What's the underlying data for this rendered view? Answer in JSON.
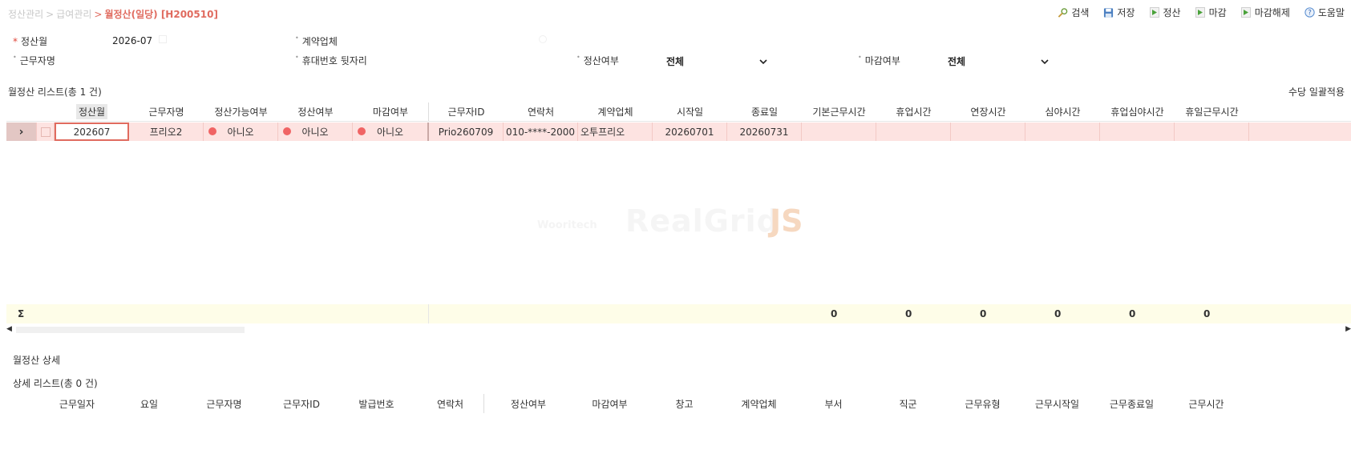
{
  "breadcrumb": {
    "crumb1": "정산관리",
    "crumb2": "급여관리",
    "current": "월정산(일당) [H200510]"
  },
  "toolbar": {
    "search": "검색",
    "save": "저장",
    "settle": "정산",
    "close": "마감",
    "unclose": "마감해제",
    "help": "도움말"
  },
  "filters": {
    "month_label": "정산월",
    "month_value": "2026-07",
    "contractor_label": "계약업체",
    "worker_label": "근무자명",
    "phone_label": "휴대번호 뒷자리",
    "settled_label": "정산여부",
    "settled_value": "전체",
    "closed_label": "마감여부",
    "closed_value": "전체"
  },
  "list": {
    "title": "월정산 리스트(총 1 건)",
    "apply_button": "수당 일괄적용",
    "columns": [
      "정산월",
      "근무자명",
      "정산가능여부",
      "정산여부",
      "마감여부",
      "근무자ID",
      "연락처",
      "계약업체",
      "시작일",
      "종료일",
      "기본근무시간",
      "휴업시간",
      "연장시간",
      "심야시간",
      "휴업심야시간",
      "휴일근무시간"
    ],
    "row": {
      "expand": "›",
      "month": "202607",
      "worker": "프리오2",
      "can_settle": "아니오",
      "settled": "아니오",
      "closed": "아니오",
      "worker_id": "Prio260709",
      "phone": "010-****-2000",
      "contractor": "오투프리오",
      "start": "20260701",
      "end": "20260731"
    },
    "sum_symbol": "Σ",
    "sums": [
      "0",
      "0",
      "0",
      "0",
      "0",
      "0"
    ]
  },
  "watermark": {
    "small": "Wooritech",
    "big": "RealGrid",
    "js": "JS"
  },
  "detail": {
    "title": "월정산 상세",
    "list_title": "상세 리스트(총 0 건)",
    "columns": [
      "근무일자",
      "요일",
      "근무자명",
      "근무자ID",
      "발급번호",
      "연락처",
      "정산여부",
      "마감여부",
      "창고",
      "계약업체",
      "부서",
      "직군",
      "근무유형",
      "근무시작일",
      "근무종료일",
      "근무시간"
    ]
  },
  "colors": {
    "accent": "#e06b5f",
    "row_bg": "#fde3e1",
    "sum_bg": "#fefde8",
    "status_dot": "#f06464"
  }
}
